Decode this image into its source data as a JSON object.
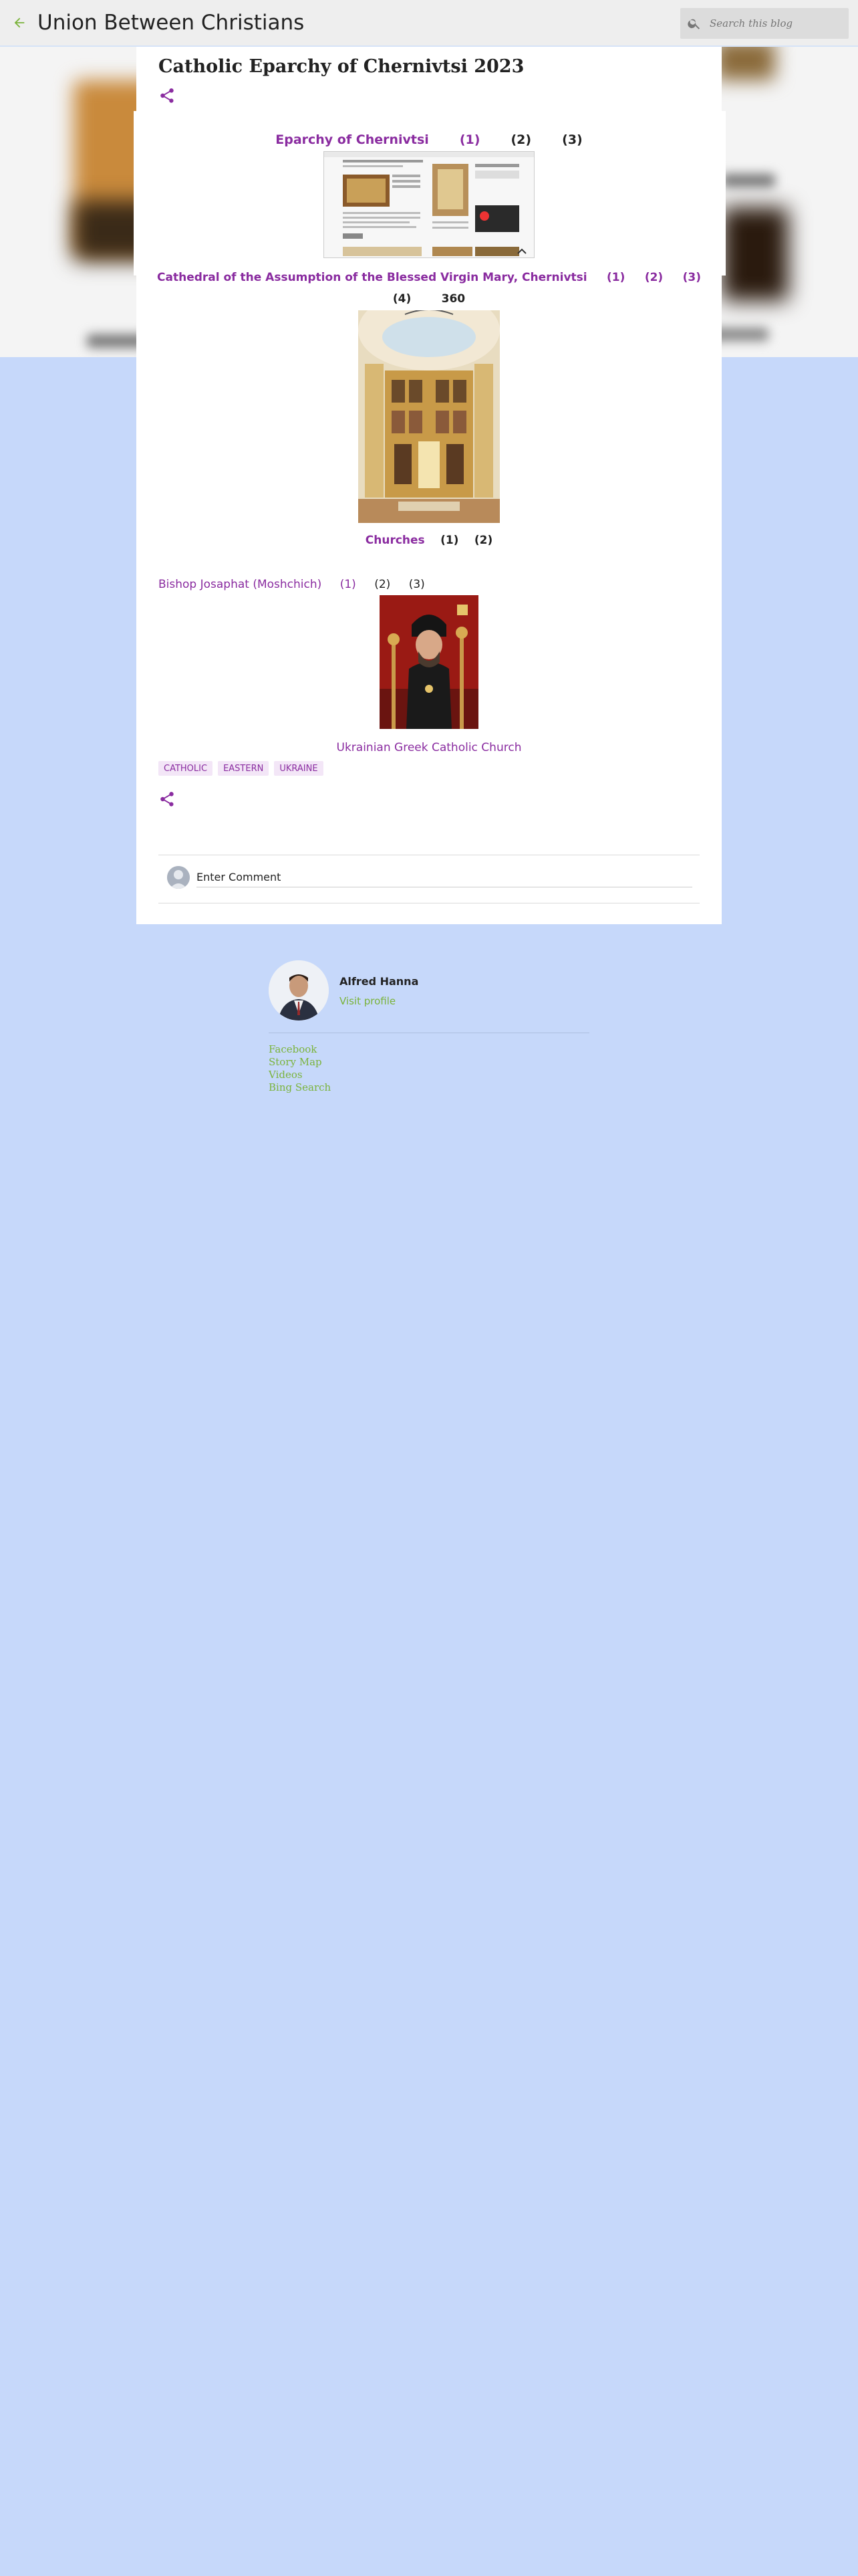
{
  "header": {
    "blog_title": "Union Between Christians",
    "search_placeholder": "Search this blog"
  },
  "post": {
    "title": "Catholic Eparchy of Chernivtsi 2023",
    "row1": {
      "link": "Eparchy of Chernivtsi",
      "items": [
        "(1)",
        "(2)",
        "(3)"
      ]
    },
    "row2": {
      "link": "Cathedral of the Assumption of the Blessed Virgin Mary, Chernivtsi",
      "items": [
        "(1)",
        "(2)",
        "(3)",
        "(4)",
        "360"
      ]
    },
    "row3": {
      "link": "Churches",
      "items": [
        "(1)",
        "(2)"
      ]
    },
    "bishop": {
      "link": "Bishop Josaphat (Moshchich)",
      "items": [
        "(1)",
        "(2)",
        "(3)"
      ]
    },
    "caption": "Ukrainian Greek Catholic Church",
    "labels": [
      "CATHOLIC",
      "EASTERN",
      "UKRAINE"
    ],
    "comment_placeholder": "Enter Comment"
  },
  "profile": {
    "name": "Alfred Hanna",
    "visit": "Visit profile"
  },
  "links": [
    "Facebook",
    "Story Map",
    "Videos",
    "Bing Search"
  ],
  "colors": {
    "link": "#8a2ca0",
    "accent_green": "#7ab33a",
    "page_bg": "#c6d8fa"
  }
}
